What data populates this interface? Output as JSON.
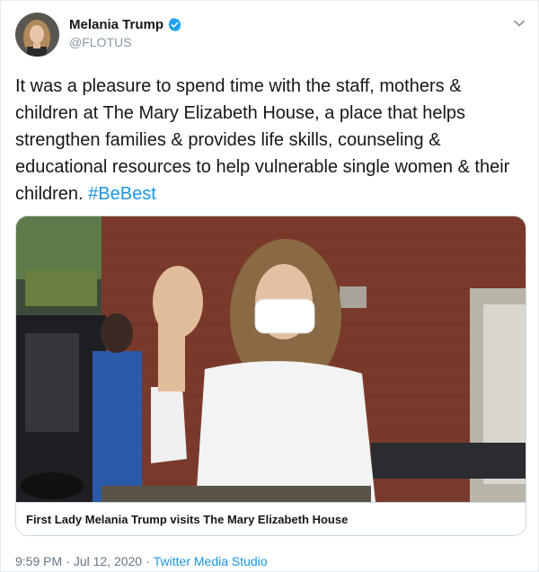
{
  "author": {
    "display_name": "Melania Trump",
    "handle": "@FLOTUS",
    "verified": true
  },
  "tweet": {
    "text": "It was a pleasure to spend time with the staff, mothers & children at The Mary Elizabeth House, a place that helps strengthen families & provides life skills, counseling & educational resources to help vulnerable single women & their children.",
    "hashtag": "#BeBest"
  },
  "media": {
    "caption": "First Lady Melania Trump visits The Mary Elizabeth House"
  },
  "meta": {
    "time": "9:59 PM",
    "separator": "·",
    "date": "Jul 12, 2020",
    "source": "Twitter Media Studio"
  },
  "colors": {
    "link": "#1b95e0",
    "verified": "#1da1f2",
    "muted": "#657786"
  },
  "icons": {
    "verified": "verified-badge-icon",
    "menu": "chevron-down-icon"
  }
}
